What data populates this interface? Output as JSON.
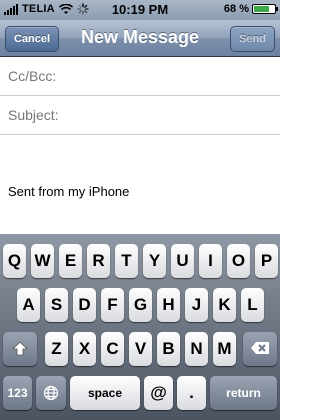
{
  "status_bar": {
    "carrier": "TELIA",
    "time": "10:19 PM",
    "battery_percent": "68 %",
    "battery_level": 0.68
  },
  "navbar": {
    "cancel_label": "Cancel",
    "title": "New Message",
    "send_label": "Send"
  },
  "fields": {
    "cc_bcc_label": "Cc/Bcc:",
    "subject_label": "Subject:"
  },
  "body": {
    "signature": "Sent from my iPhone"
  },
  "keyboard": {
    "row1": [
      "Q",
      "W",
      "E",
      "R",
      "T",
      "Y",
      "U",
      "I",
      "O",
      "P"
    ],
    "row2": [
      "A",
      "S",
      "D",
      "F",
      "G",
      "H",
      "J",
      "K",
      "L"
    ],
    "row3": [
      "Z",
      "X",
      "C",
      "V",
      "B",
      "N",
      "M"
    ],
    "numbers_label": "123",
    "space_label": "space",
    "at_label": "@",
    "period_label": ".",
    "return_label": "return"
  }
}
